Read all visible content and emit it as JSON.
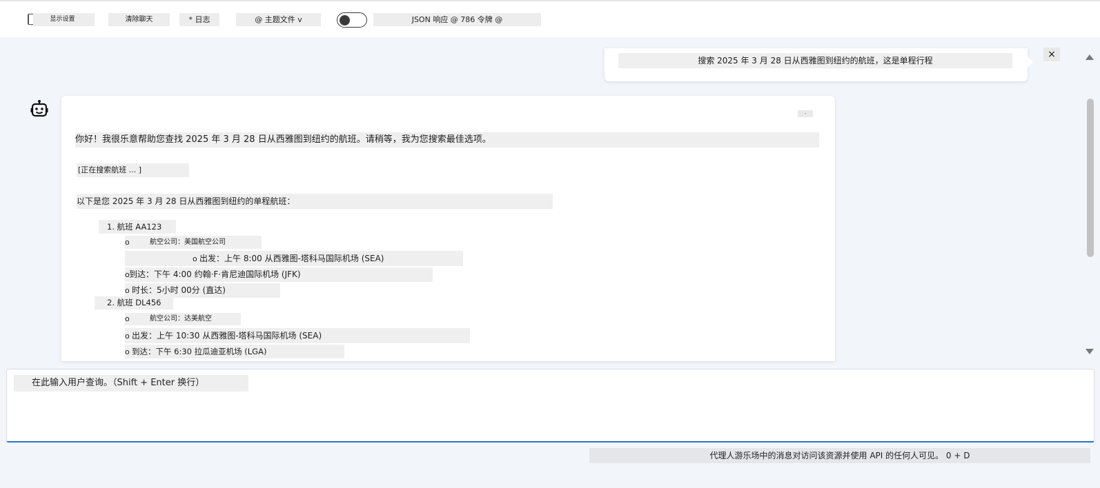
{
  "toolbar": {
    "settings_label": "显示设置",
    "clear_label": "清除聊天",
    "log_label": "* 日志",
    "theme_label": "@ 主题文件 v",
    "json_label": "JSON 响应 @ 786 令牌 @"
  },
  "user_message": {
    "text": "搜索 2025 年 3 月 28 日从西雅图到纽约的航班，这是单程行程",
    "close_label": "×"
  },
  "assistant": {
    "copy_label": "-",
    "greeting": "你好！我很乐意帮助您查找 2025 年 3 月 28 日从西雅图到纽约的航班。请稍等，我为您搜索最佳选项。",
    "searching": "[正在搜索航班 ... ]",
    "intro": "以下是您 2025 年 3 月 28 日从西雅图到纽约的单程航班：",
    "flights": [
      {
        "title": "1. 航班 AA123",
        "airline": "航空公司：美国航空公司",
        "departure": "出发：上午 8:00 从西雅图-塔科马国际机场 (SEA)",
        "arrival": "到达：下午 4:00 约翰·F·肯尼迪国际机场 (JFK)",
        "duration": "时长：5小时 00分 (直达)"
      },
      {
        "title": "2. 航班 DL456",
        "airline": "航空公司：达美航空",
        "departure": "出发：上午 10:30 从西雅图-塔科马国际机场 (SEA)",
        "arrival": "到达：下午 6:30 拉瓜迪亚机场 (LGA)"
      }
    ]
  },
  "input": {
    "placeholder": "在此输入用户查询。（Shift + Enter 换行）"
  },
  "footer": {
    "note": "代理人游乐场中的消息对访问该资源并使用 API 的任何人可见。 0 + D"
  },
  "bullet_char": "o",
  "toggle_on": false
}
